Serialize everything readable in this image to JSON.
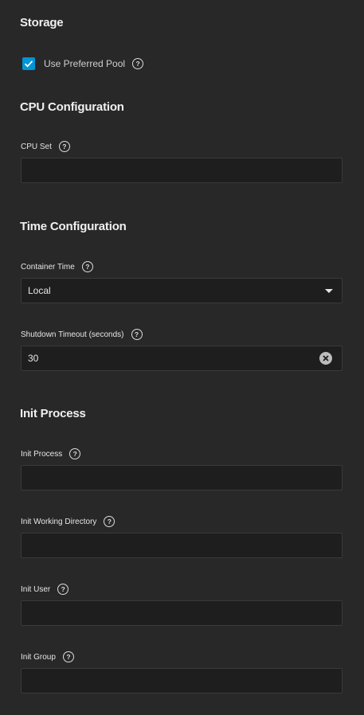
{
  "storage": {
    "title": "Storage",
    "use_preferred_pool": {
      "label": "Use Preferred Pool",
      "checked": true
    }
  },
  "cpu": {
    "title": "CPU Configuration",
    "cpu_set": {
      "label": "CPU Set",
      "value": ""
    }
  },
  "time": {
    "title": "Time Configuration",
    "container_time": {
      "label": "Container Time",
      "value": "Local"
    },
    "shutdown_timeout": {
      "label": "Shutdown Timeout (seconds)",
      "value": "30"
    }
  },
  "init": {
    "title": "Init Process",
    "process": {
      "label": "Init Process",
      "value": ""
    },
    "working_directory": {
      "label": "Init Working Directory",
      "value": ""
    },
    "user": {
      "label": "Init User",
      "value": ""
    },
    "group": {
      "label": "Init Group",
      "value": ""
    }
  },
  "icons": {
    "help": "?",
    "checkmark": "check-icon",
    "dropdown": "caret-down-icon",
    "clear": "close-circle-icon"
  },
  "colors": {
    "background": "#282828",
    "input_bg": "#1e1e1e",
    "accent": "#0095d5"
  }
}
